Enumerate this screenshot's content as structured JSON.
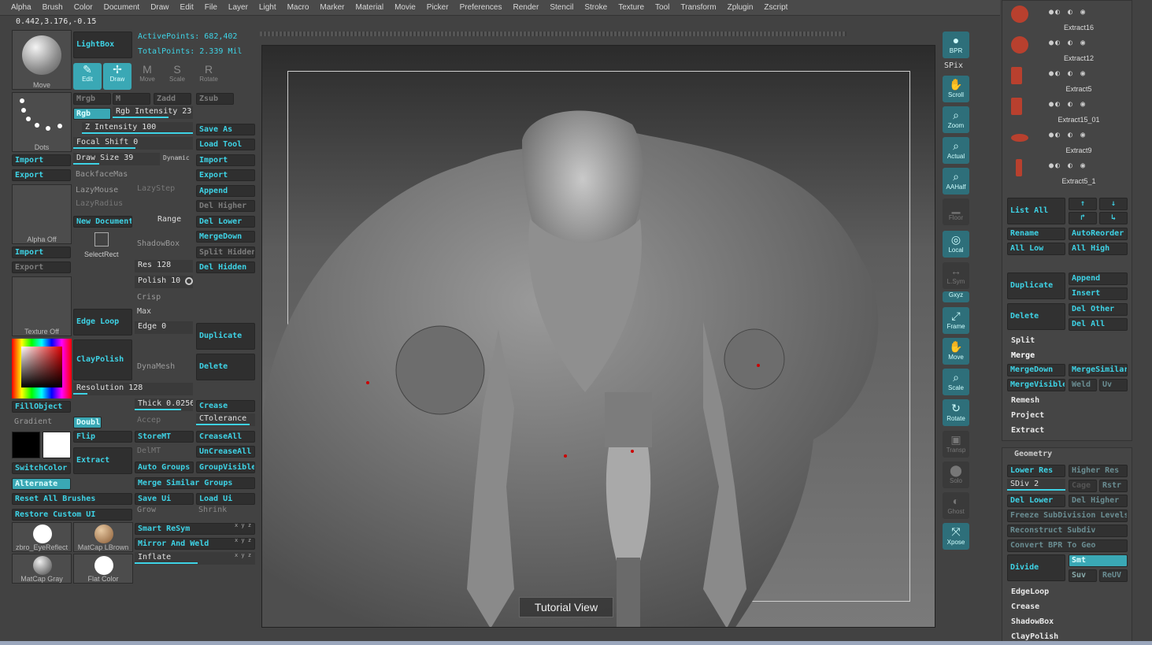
{
  "menu": [
    "Alpha",
    "Brush",
    "Color",
    "Document",
    "Draw",
    "Edit",
    "File",
    "Layer",
    "Light",
    "Macro",
    "Marker",
    "Material",
    "Movie",
    "Picker",
    "Preferences",
    "Render",
    "Stencil",
    "Stroke",
    "Texture",
    "Tool",
    "Transform",
    "Zplugin",
    "Zscript"
  ],
  "status": {
    "coords": "0.442,3.176,-0.15",
    "active_points": "ActivePoints: 682,402",
    "total_points": "TotalPoints: 2.339 Mil"
  },
  "left": {
    "move_label": "Move",
    "dots_label": "Dots",
    "import": "Import",
    "export": "Export",
    "alpha_off": "Alpha Off",
    "texture_off": "Texture Off",
    "fillobject": "FillObject",
    "gradient": "Gradient",
    "switchcolor": "SwitchColor",
    "alternate": "Alternate",
    "matcap1": "zbro_EyeReflect",
    "matcap2": "MatCap LBrown",
    "matcap3": "MatCap Gray",
    "matcap4": "Flat Color"
  },
  "col2": {
    "lightbox": "LightBox",
    "edit": "Edit",
    "draw": "Draw",
    "move": "Move",
    "scale": "Scale",
    "rotate": "Rotate",
    "mrgb": "Mrgb",
    "m": "M",
    "zadd": "Zadd",
    "zsub": "Zsub",
    "rgb": "Rgb",
    "rgb_intensity": "Rgb Intensity 23",
    "z_intensity": "Z Intensity 100",
    "focal_shift": "Focal Shift 0",
    "draw_size": "Draw Size 39",
    "dynamic": "Dynamic",
    "backfacemas": "BackfaceMas",
    "lazymouse": "LazyMouse",
    "lazystep": "LazyStep",
    "lazyradius": "LazyRadius",
    "new_document": "New Document",
    "range": "Range",
    "selectrect": "SelectRect",
    "shadowbox": "ShadowBox",
    "res": "Res 128",
    "polish": "Polish 10",
    "crisp": "Crisp",
    "max": "Max",
    "edge": "Edge 0",
    "edge_loop": "Edge Loop",
    "claypolish": "ClayPolish",
    "dynamesh": "DynaMesh",
    "resolution": "Resolution 128",
    "thick": "Thick 0.0256",
    "accep": "Accep",
    "doubl": "Doubl",
    "flip": "Flip",
    "storemt": "StoreMT",
    "delmt": "DelMT",
    "extract": "Extract",
    "auto_groups": "Auto Groups",
    "merge_similar": "Merge Similar Groups",
    "reset_brushes": "Reset All Brushes",
    "save_ui": "Save Ui",
    "load_ui": "Load Ui",
    "grow": "Grow",
    "shrink": "Shrink",
    "restore_ui": "Restore Custom UI",
    "smart_resym": "Smart ReSym",
    "mirror_weld": "Mirror And Weld",
    "inflate": "Inflate",
    "xyz": "x y z"
  },
  "col3": {
    "save_as": "Save As",
    "load_tool": "Load Tool",
    "import": "Import",
    "export": "Export",
    "append": "Append",
    "del_higher": "Del Higher",
    "del_lower": "Del Lower",
    "mergedown": "MergeDown",
    "split_hidden": "Split Hidden",
    "del_hidden": "Del Hidden",
    "duplicate": "Duplicate",
    "delete": "Delete",
    "crease": "Crease",
    "ctolerance": "CTolerance",
    "creaseall": "CreaseAll",
    "uncreaseall": "UnCreaseAll",
    "groupvisible": "GroupVisible"
  },
  "viewport": {
    "tutorial": "Tutorial View"
  },
  "shelf": [
    "BPR",
    "SPix",
    "Scroll",
    "Zoom",
    "Actual",
    "AAHalf",
    "Floor",
    "Local",
    "L.Sym",
    "Gxyz",
    "Frame",
    "Move",
    "Scale",
    "Rotate",
    "Transp",
    "Solo",
    "Ghost",
    "Xpose"
  ],
  "subtools": [
    "Extract16",
    "Extract12",
    "Extract5",
    "Extract15_01",
    "Extract9",
    "Extract5_1"
  ],
  "subtool_panel": {
    "list_all": "List All",
    "rename": "Rename",
    "autoreorder": "AutoReorder",
    "all_low": "All Low",
    "all_high": "All High",
    "append": "Append",
    "insert": "Insert",
    "duplicate": "Duplicate",
    "del_other": "Del Other",
    "delete": "Delete",
    "del_all": "Del All",
    "split": "Split",
    "merge": "Merge",
    "mergedown": "MergeDown",
    "mergesimilar": "MergeSimilar",
    "mergevisible": "MergeVisible",
    "weld": "Weld",
    "uv": "Uv",
    "remesh": "Remesh",
    "project": "Project",
    "extract": "Extract"
  },
  "geometry": {
    "title": "Geometry",
    "lower_res": "Lower Res",
    "higher_res": "Higher Res",
    "sdiv": "SDiv 2",
    "cage": "Cage",
    "rstr": "Rstr",
    "del_lower": "Del Lower",
    "del_higher": "Del Higher",
    "freeze": "Freeze SubDivision Levels",
    "reconstruct": "Reconstruct Subdiv",
    "convert_bpr": "Convert BPR To Geo",
    "divide": "Divide",
    "smt": "Smt",
    "suv": "Suv",
    "reuv": "ReUV",
    "edgeloop": "EdgeLoop",
    "crease": "Crease",
    "shadowbox": "ShadowBox",
    "claypolish": "ClayPolish"
  }
}
